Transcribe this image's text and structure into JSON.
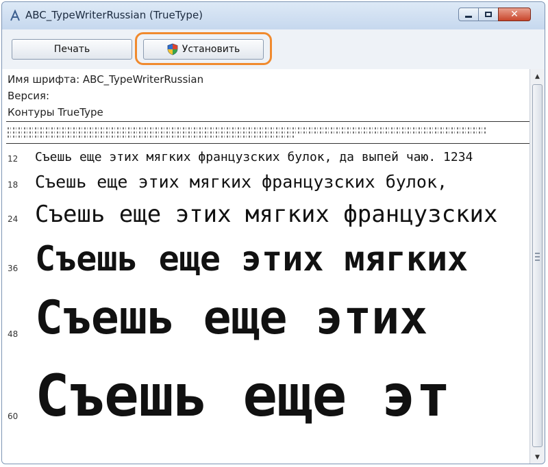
{
  "window": {
    "title": "ABC_TypeWriterRussian (TrueType)"
  },
  "toolbar": {
    "print_label": "Печать",
    "install_label": "Установить"
  },
  "info": {
    "font_name": "Имя шрифта: ABC_TypeWriterRussian",
    "version": "Версия:",
    "outlines": "Контуры TrueType"
  },
  "samples": [
    {
      "size": "12",
      "text": "Съешь еще этих мягких французских булок, да выпей чаю. 1234"
    },
    {
      "size": "18",
      "text": "Съешь еще этих мягких французских булок,"
    },
    {
      "size": "24",
      "text": "Съешь еще этих мягких французских"
    },
    {
      "size": "36",
      "text": "Съешь еще этих мягких"
    },
    {
      "size": "48",
      "text": "Съешь еще этих"
    },
    {
      "size": "60",
      "text": "Съешь еще эт"
    }
  ],
  "icons": {
    "app": "font-app-icon",
    "install": "uac-shield-icon",
    "minimize": "minimize-icon",
    "maximize": "maximize-icon",
    "close": "close-icon"
  },
  "colors": {
    "highlight": "#f08a2e",
    "close": "#c8452b"
  }
}
